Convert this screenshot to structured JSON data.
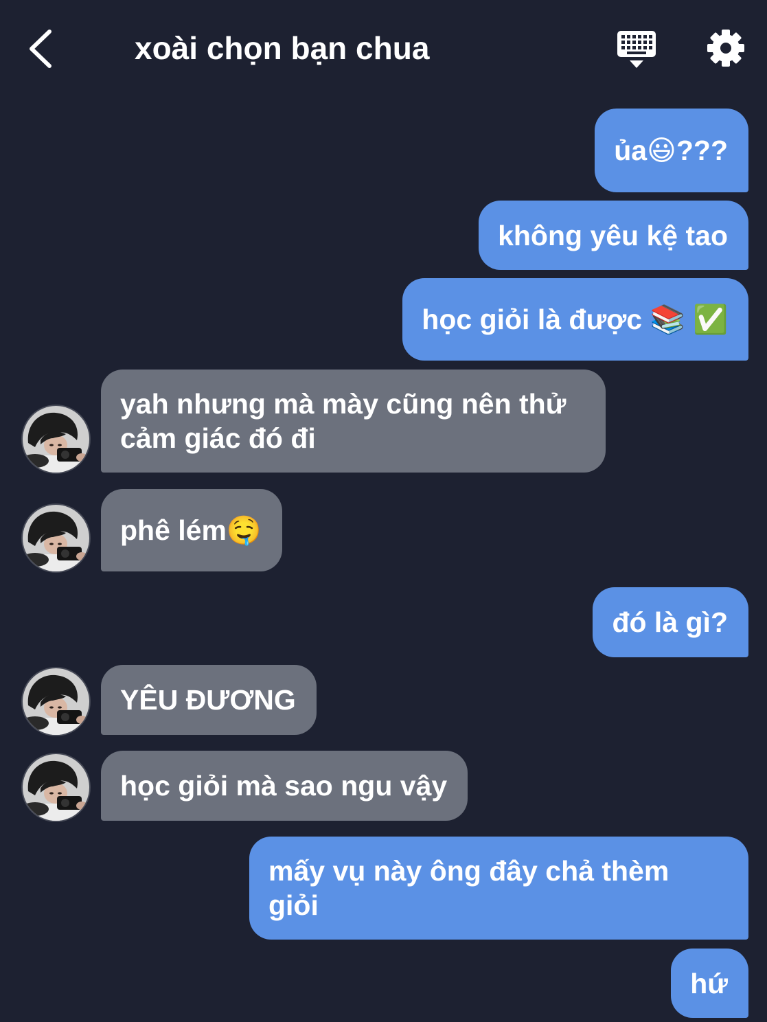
{
  "header": {
    "title": "xoài chọn bạn chua",
    "icons": {
      "back": "chevron-left-icon",
      "keyboard": "keyboard-icon",
      "settings": "gear-icon",
      "avatar": "avatar-photo"
    }
  },
  "colors": {
    "background": "#1d2131",
    "outgoing_bubble": "#5b91e5",
    "incoming_bubble": "#6c717d",
    "text": "#ffffff"
  },
  "messages": [
    {
      "outgoing": true,
      "text": "ủa😃???"
    },
    {
      "outgoing": true,
      "text": "không yêu kệ tao"
    },
    {
      "outgoing": true,
      "text": "học giỏi là được 📚 ✅"
    },
    {
      "outgoing": false,
      "text": "yah nhưng mà mày cũng nên thử cảm giác đó đi"
    },
    {
      "outgoing": false,
      "text": "phê lém🤤"
    },
    {
      "outgoing": true,
      "text": "đó là gì?"
    },
    {
      "outgoing": false,
      "text": "YÊU ĐƯƠNG"
    },
    {
      "outgoing": false,
      "text": "học giỏi mà sao ngu vậy"
    },
    {
      "outgoing": true,
      "text": "mấy vụ này ông đây chả thèm giỏi"
    },
    {
      "outgoing": true,
      "text": "hứ"
    }
  ]
}
